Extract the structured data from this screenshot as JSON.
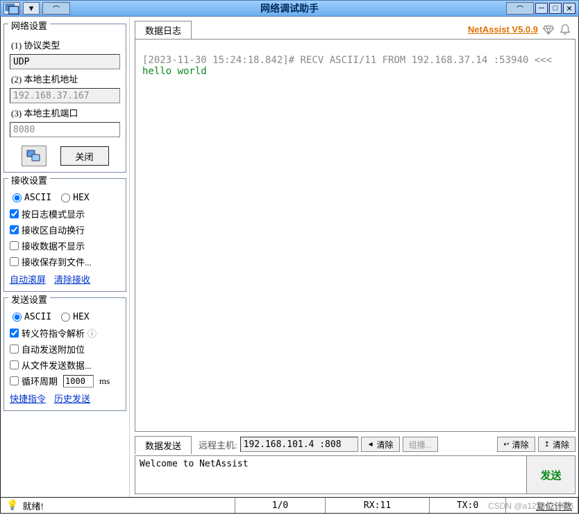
{
  "window": {
    "title": "网络调试助手"
  },
  "version": {
    "label": "NetAssist V5.0.9"
  },
  "tabs": {
    "log": "数据日志",
    "send": "数据发送"
  },
  "network": {
    "group_title": "网络设置",
    "protocol_label": "(1) 协议类型",
    "protocol_value": "UDP",
    "hostaddr_label": "(2) 本地主机地址",
    "hostaddr_value": "192.168.37.167",
    "hostport_label": "(3) 本地主机端口",
    "hostport_value": "8080",
    "action_btn": "关闭"
  },
  "recv": {
    "group_title": "接收设置",
    "radios": {
      "ascii": "ASCII",
      "hex": "HEX"
    },
    "checks": {
      "log_mode": "按日志模式显示",
      "auto_wrap": "接收区自动换行",
      "no_display": "接收数据不显示",
      "save_file": "接收保存到文件..."
    },
    "links": {
      "autoscroll": "自动滚屏",
      "clear": "清除接收"
    }
  },
  "send": {
    "group_title": "发送设置",
    "radios": {
      "ascii": "ASCII",
      "hex": "HEX"
    },
    "checks": {
      "escape": "转义符指令解析",
      "auto_append": "自动发送附加位",
      "from_file": "从文件发送数据...",
      "loop": "循环周期"
    },
    "loop_value": "1000",
    "loop_unit": "ms",
    "links": {
      "quick": "快捷指令",
      "history": "历史发送"
    }
  },
  "log": {
    "lines": [
      {
        "type": "meta",
        "text": "[2023-11-30 15:24:18.842]# RECV ASCII/11 FROM 192.168.37.14 :53940 <<<"
      },
      {
        "type": "data",
        "text": "hello world"
      }
    ]
  },
  "sendbar": {
    "remote_label": "远程主机:",
    "remote_value": "192.168.101.4 :808",
    "clear_btn": "清除",
    "multicast": "组播...",
    "clear_btn2": "清除",
    "text": "Welcome to NetAssist",
    "send_btn": "发送"
  },
  "status": {
    "ready": "就绪!",
    "counter1": "1/0",
    "rx": "RX:11",
    "tx": "TX:0",
    "reset": "复位计数"
  },
  "watermark": "CSDN @a1230123456"
}
